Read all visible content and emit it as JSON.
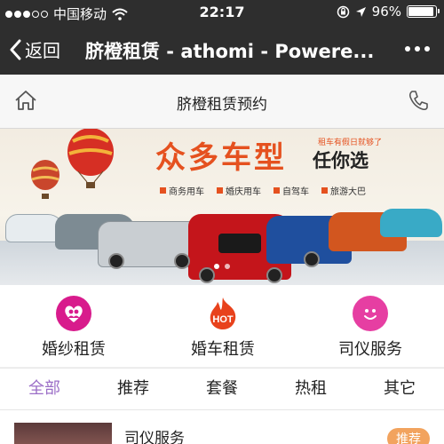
{
  "status_bar": {
    "carrier": "中国移动",
    "time": "22:17",
    "battery": "96%",
    "battery_level": 0.96,
    "signal_icon": "signal-dots-icon",
    "wifi_icon": "wifi-icon",
    "lock_icon": "rotation-lock-icon",
    "location_icon": "location-arrow-icon"
  },
  "nav": {
    "back_label": "返回",
    "title": "脐橙租赁 - athomi - Powere...",
    "more_icon": "more-dots-icon"
  },
  "header": {
    "title": "脐橙租赁预约",
    "home_icon": "home-icon",
    "phone_icon": "phone-icon"
  },
  "banner": {
    "headline": "众多车型",
    "tagline_small": "租车有假日就够了",
    "subheadline": "任你选",
    "tags": [
      "商务用车",
      "婚庆用车",
      "自驾车",
      "旅游大巴"
    ]
  },
  "services": [
    {
      "label": "婚纱租赁",
      "icon": "couple-icon",
      "color": "#d81b8c"
    },
    {
      "label": "婚车租赁",
      "icon": "hot-fire-icon",
      "badge": "HOT",
      "color": "#e8421c"
    },
    {
      "label": "司仪服务",
      "icon": "smiley-icon",
      "color": "#e63ea2"
    }
  ],
  "tabs": [
    {
      "label": "全部",
      "active": true
    },
    {
      "label": "推荐"
    },
    {
      "label": "套餐"
    },
    {
      "label": "热租"
    },
    {
      "label": "其它"
    }
  ],
  "list": [
    {
      "title": "司仪服务",
      "badge": "推荐"
    }
  ],
  "colors": {
    "topbar": "#2e2e2e",
    "accent_tab": "#9b6ec7",
    "banner_orange": "#e5511f",
    "badge": "#f2a35e"
  }
}
